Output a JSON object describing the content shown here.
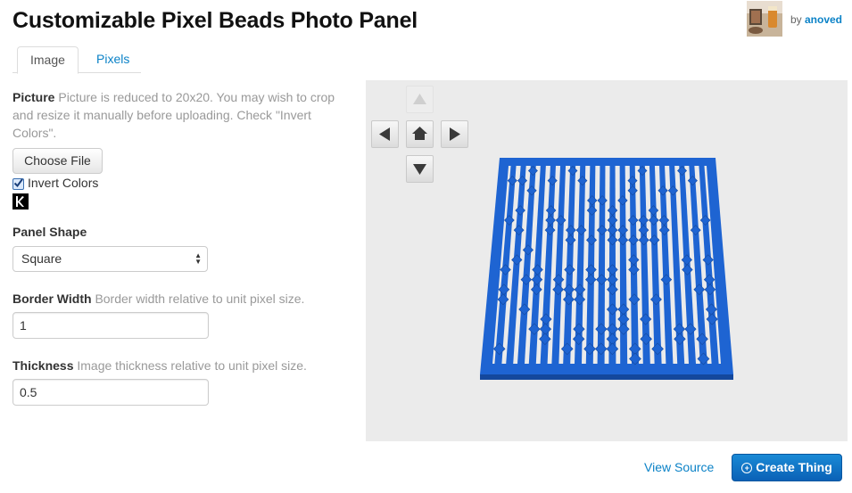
{
  "header": {
    "title": "Customizable Pixel Beads Photo Panel",
    "by_prefix": "by",
    "author": "anoved"
  },
  "tabs": [
    {
      "label": "Image",
      "active": true
    },
    {
      "label": "Pixels",
      "active": false
    }
  ],
  "form": {
    "picture": {
      "label": "Picture",
      "help": "Picture is reduced to 20x20. You may wish to crop and resize it manually before uploading. Check \"Invert Colors\".",
      "choose_file_label": "Choose File",
      "invert_label": "Invert Colors",
      "invert_checked": true
    },
    "panel_shape": {
      "label": "Panel Shape",
      "selected": "Square"
    },
    "border_width": {
      "label": "Border Width",
      "help": "Border width relative to unit pixel size.",
      "value": "1"
    },
    "thickness": {
      "label": "Thickness",
      "help": "Image thickness relative to unit pixel size.",
      "value": "0.5"
    }
  },
  "viewer": {
    "background": "#ebebeb",
    "model_color": "#1e64d2",
    "controls": [
      "up-arrow-icon",
      "left-arrow-icon",
      "home-icon",
      "right-arrow-icon",
      "down-arrow-icon"
    ]
  },
  "footer": {
    "view_source_label": "View Source",
    "create_thing_label": "Create Thing"
  },
  "colors": {
    "link": "#0b82c7",
    "primary_button": "#0a6fc2"
  }
}
